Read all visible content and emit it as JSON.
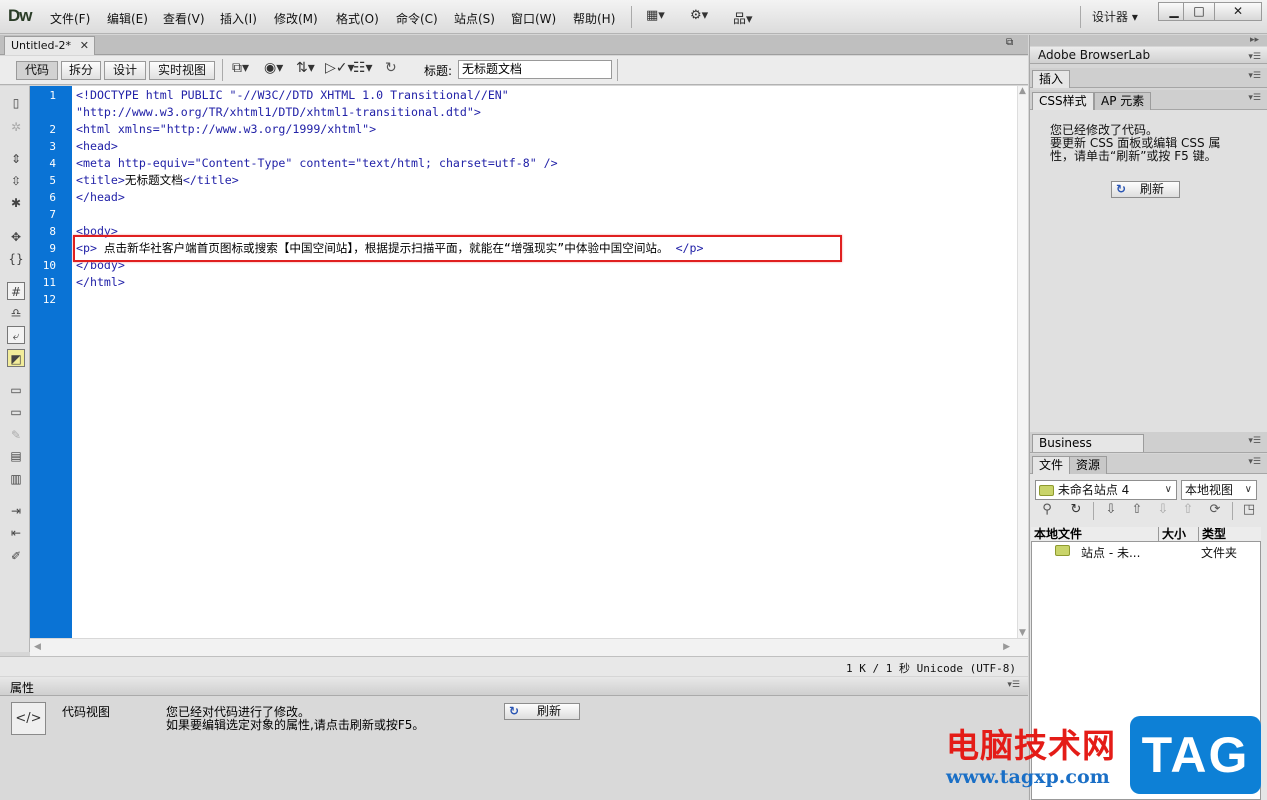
{
  "app": {
    "logo": "Dw",
    "menu": [
      "文件(F)",
      "编辑(E)",
      "查看(V)",
      "插入(I)",
      "修改(M)",
      "格式(O)",
      "命令(C)",
      "站点(S)",
      "窗口(W)",
      "帮助(H)"
    ],
    "layout_icon": "layout-icon",
    "gear_icon": "gear-icon",
    "site_icon": "site-icon",
    "workspace": "设计器 ▾",
    "window_controls": [
      "▁",
      "□",
      "✕"
    ]
  },
  "document": {
    "tab": "Untitled-2*",
    "tab_close": "✕",
    "restore_icon": "⧉",
    "view_buttons": [
      "代码",
      "拆分",
      "设计",
      "实时视图"
    ],
    "title_label": "标题:",
    "title_value": "无标题文档"
  },
  "code": {
    "line_numbers": [
      "1",
      "",
      "2",
      "3",
      "4",
      "5",
      "6",
      "7",
      "8",
      "9",
      "10",
      "11",
      "12"
    ],
    "lines": [
      "<!DOCTYPE html PUBLIC \"-//W3C//DTD XHTML 1.0 Transitional//EN\"",
      "\"http://www.w3.org/TR/xhtml1/DTD/xhtml1-transitional.dtd\">",
      "<html xmlns=\"http://www.w3.org/1999/xhtml\">",
      "<head>",
      "<meta http-equiv=\"Content-Type\" content=\"text/html; charset=utf-8\" />",
      "<title>无标题文档</title>",
      "</head>",
      "",
      "<body>",
      "<p> 点击新华社客户端首页图标或搜索【中国空间站】，根据提示扫描平面，就能在“增强现实”中体验中国空间站。 </p>",
      "</body>",
      "</html>",
      ""
    ]
  },
  "status": {
    "text": "1 K / 1 秒  Unicode (UTF-8)"
  },
  "properties": {
    "title": "属性",
    "code_view_label": "代码视图",
    "message_line1": "您已经对代码进行了修改。",
    "message_line2": "如果要编辑选定对象的属性,请点击刷新或按F5。",
    "refresh_label": "刷新"
  },
  "panels": {
    "browserlab": "Adobe BrowserLab",
    "insert": "插入",
    "css_tab": "CSS样式",
    "ap_tab": "AP 元素",
    "css_msg": [
      "您已经修改了代码。",
      "要更新 CSS 面板或编辑 CSS 属",
      "性，请单击“刷新”或按 F5 键。"
    ],
    "css_refresh": "刷新",
    "business_catalyst": "Business Catalyst",
    "files_tab": "文件",
    "assets_tab": "资源",
    "site_select": "未命名站点 4",
    "view_select": "本地视图",
    "columns": [
      "本地文件",
      "大小",
      "类型"
    ],
    "row": {
      "name": "站点 - 未...",
      "type": "文件夹"
    }
  },
  "watermark": {
    "text": "电脑技术网",
    "url": "www.tagxp.com",
    "tag": "TAG"
  }
}
